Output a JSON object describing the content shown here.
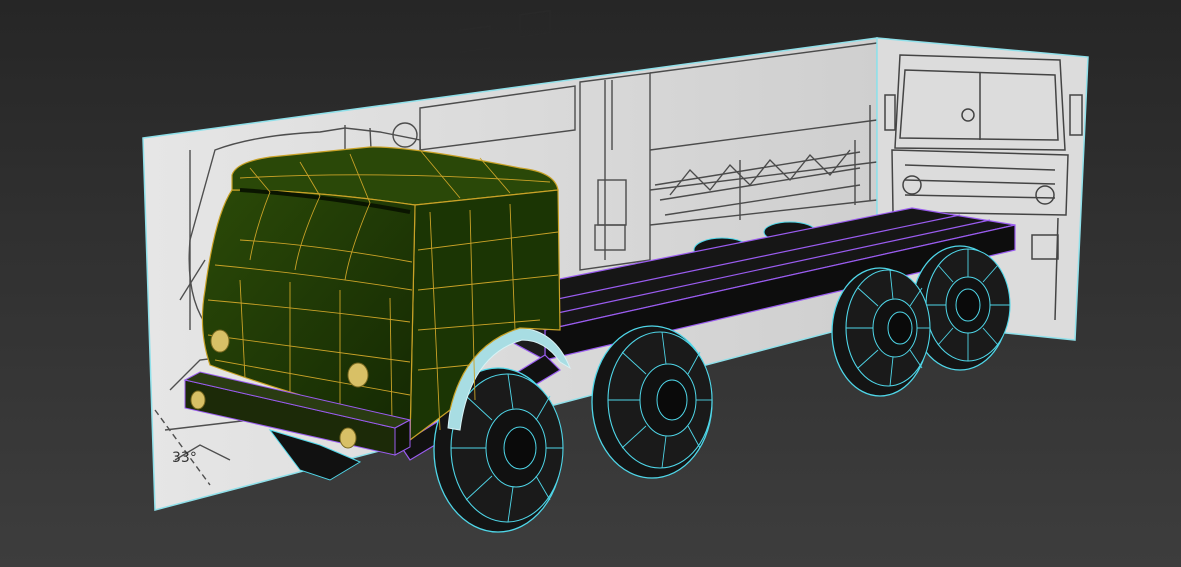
{
  "viewport": {
    "background_top": "#262626",
    "background_bottom": "#3d3d3d"
  },
  "scene": {
    "model": "truck-lowpoly-wip",
    "reference_planes": [
      "side-view-blueprint",
      "front-view-blueprint"
    ],
    "reference_plane_text": [
      "33°"
    ],
    "colors": {
      "cab_fill": "#1f3a05",
      "cab_fill_dark": "#142803",
      "cab_wire": "#c9a227",
      "wheel_fill": "#141414",
      "wheel_wire": "#4fd6e8",
      "frame_fill": "#141414",
      "frame_wire": "#9a5cf0",
      "fender": "#a8dde3",
      "headlight": "#d8c066",
      "blueprint_bg": "#dadada",
      "blueprint_line": "#222222"
    }
  }
}
